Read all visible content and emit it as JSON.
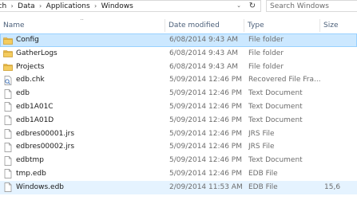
{
  "address": {
    "crumbs": [
      "rch",
      "Data",
      "Applications",
      "Windows"
    ],
    "separator": "›",
    "dropdown": "⌄",
    "refresh": "↻"
  },
  "search": {
    "placeholder": "Search Windows"
  },
  "columns": {
    "name": "Name",
    "date": "Date modified",
    "type": "Type",
    "size": "Size",
    "sort_indicator": "^"
  },
  "files": [
    {
      "name": "Config",
      "date": "6/08/2014 9:43 AM",
      "type": "File folder",
      "size": "",
      "icon": "folder-icon",
      "state": "selected"
    },
    {
      "name": "GatherLogs",
      "date": "6/08/2014 9:43 AM",
      "type": "File folder",
      "size": "",
      "icon": "folder-icon",
      "state": ""
    },
    {
      "name": "Projects",
      "date": "6/08/2014 9:43 AM",
      "type": "File folder",
      "size": "",
      "icon": "folder-icon",
      "state": ""
    },
    {
      "name": "edb.chk",
      "date": "5/09/2014 12:46 PM",
      "type": "Recovered File Fra...",
      "size": "",
      "icon": "chk-file-icon",
      "state": ""
    },
    {
      "name": "edb",
      "date": "5/09/2014 12:46 PM",
      "type": "Text Document",
      "size": "",
      "icon": "file-icon",
      "state": ""
    },
    {
      "name": "edb1A01C",
      "date": "5/09/2014 12:46 PM",
      "type": "Text Document",
      "size": "",
      "icon": "file-icon",
      "state": ""
    },
    {
      "name": "edb1A01D",
      "date": "5/09/2014 12:46 PM",
      "type": "Text Document",
      "size": "",
      "icon": "file-icon",
      "state": ""
    },
    {
      "name": "edbres00001.jrs",
      "date": "5/09/2014 12:46 PM",
      "type": "JRS File",
      "size": "",
      "icon": "file-icon",
      "state": ""
    },
    {
      "name": "edbres00002.jrs",
      "date": "5/09/2014 12:46 PM",
      "type": "JRS File",
      "size": "",
      "icon": "file-icon",
      "state": ""
    },
    {
      "name": "edbtmp",
      "date": "5/09/2014 12:46 PM",
      "type": "Text Document",
      "size": "",
      "icon": "file-icon",
      "state": ""
    },
    {
      "name": "tmp.edb",
      "date": "5/09/2014 12:46 PM",
      "type": "EDB File",
      "size": "",
      "icon": "file-icon",
      "state": ""
    },
    {
      "name": "Windows.edb",
      "date": "2/09/2014 11:53 AM",
      "type": "EDB File",
      "size": "15,6",
      "icon": "file-icon",
      "state": "hover"
    }
  ],
  "colors": {
    "selected_bg": "#cce8ff",
    "selected_border": "#99d1ff",
    "hover_bg": "#e5f3ff",
    "folder": "#e8b94a",
    "header_text": "#4c607a"
  }
}
